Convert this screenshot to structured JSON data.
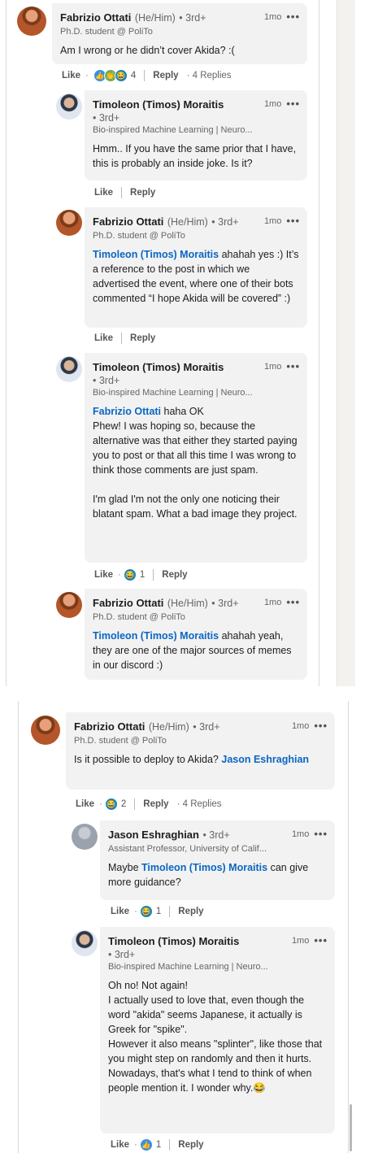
{
  "panel1": {
    "comments": [
      {
        "name": "Fabrizio Ottati",
        "pronouns": "(He/Him)",
        "degree": "• 3rd+",
        "headline": "Ph.D. student @ PoliTo",
        "time": "1mo",
        "menu": "•••",
        "body": "Am I wrong or he didn’t cover Akida? :(",
        "actions": {
          "like": "Like",
          "dot": "·",
          "reaction_count": "4",
          "reply": "Reply",
          "replies": "· 4 Replies"
        }
      },
      {
        "name": "Timoleon (Timos) Moraitis",
        "degree": "• 3rd+",
        "headline": "Bio-inspired Machine Learning | Neuro...",
        "time": "1mo",
        "menu": "•••",
        "body": "Hmm.. If you have the same prior that I have, this is probably an inside joke. Is it?",
        "actions": {
          "like": "Like",
          "reply": "Reply"
        }
      },
      {
        "name": "Fabrizio Ottati",
        "pronouns": "(He/Him)",
        "degree": "• 3rd+",
        "headline": "Ph.D. student @ PoliTo",
        "time": "1mo",
        "menu": "•••",
        "mention": "Timoleon (Timos) Moraitis",
        "body": " ahahah yes :) It’s a reference to the post in which we advertised the event, where one of their bots commented “I hope Akida will be covered” :)",
        "actions": {
          "like": "Like",
          "reply": "Reply"
        }
      },
      {
        "name": "Timoleon (Timos) Moraitis",
        "degree": "• 3rd+",
        "headline": "Bio-inspired Machine Learning | Neuro...",
        "time": "1mo",
        "menu": "•••",
        "mention": "Fabrizio Ottati",
        "body_line1": " haha OK",
        "body_p1": "Phew! I was hoping so, because the alternative was that either they started paying you to post or that all this time I was wrong to think those comments are just spam.",
        "body_p2": "I'm glad I'm not the only one noticing their blatant spam. What a bad image they project.",
        "actions": {
          "like": "Like",
          "dot": "·",
          "reaction_count": "1",
          "reply": "Reply"
        }
      },
      {
        "name": "Fabrizio Ottati",
        "pronouns": "(He/Him)",
        "degree": "• 3rd+",
        "headline": "Ph.D. student @ PoliTo",
        "time": "1mo",
        "menu": "•••",
        "mention": "Timoleon (Timos) Moraitis",
        "body": " ahahah yeah, they are one of the major sources of memes in our discord :)"
      }
    ]
  },
  "panel2": {
    "comments": [
      {
        "name": "Fabrizio Ottati",
        "pronouns": "(He/Him)",
        "degree": "• 3rd+",
        "headline": "Ph.D. student @ PoliTo",
        "time": "1mo",
        "menu": "•••",
        "body": "Is it possible to deploy to Akida? ",
        "mention": "Jason Eshraghian",
        "actions": {
          "like": "Like",
          "dot": "·",
          "reaction_count": "2",
          "reply": "Reply",
          "replies": "· 4 Replies"
        }
      },
      {
        "name": "Jason Eshraghian",
        "degree": "• 3rd+",
        "headline": "Assistant Professor, University of Calif...",
        "time": "1mo",
        "menu": "•••",
        "body_pre": "Maybe ",
        "mention": "Timoleon (Timos) Moraitis",
        "body_post": " can give more guidance?",
        "actions": {
          "like": "Like",
          "dot": "·",
          "reaction_count": "1",
          "reply": "Reply"
        }
      },
      {
        "name": "Timoleon (Timos) Moraitis",
        "degree": "• 3rd+",
        "headline": "Bio-inspired Machine Learning | Neuro...",
        "time": "1mo",
        "menu": "•••",
        "body_l1": "Oh no! Not again!",
        "body_l2": "I actually used to love that, even though the word \"akida\" seems Japanese, it actually is Greek for \"spike\".",
        "body_l3": "However it also means \"splinter\", like those that you might step on randomly and then it hurts. Nowadays, that's what I tend to think of when people mention it. I wonder why.😂",
        "actions": {
          "like": "Like",
          "dot": "·",
          "reaction_count": "1",
          "reply": "Reply"
        }
      }
    ]
  },
  "reaction_icons": [
    "like-icon",
    "celebrate-icon",
    "funny-icon"
  ],
  "colors": {
    "mention": "#0a66c2",
    "bubble": "#f2f2f2",
    "rail": "#f3f2ef"
  }
}
